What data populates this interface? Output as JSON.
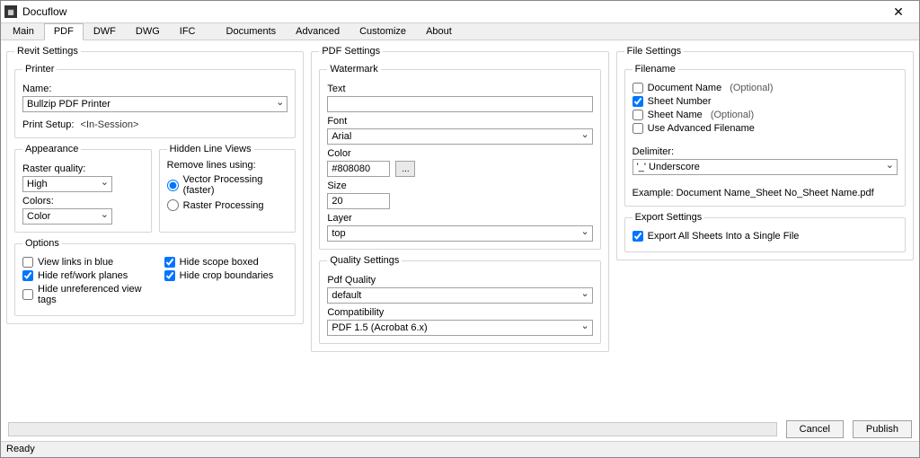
{
  "window": {
    "title": "Docuflow"
  },
  "tabs": [
    "Main",
    "PDF",
    "DWF",
    "DWG",
    "IFC",
    "Documents",
    "Advanced",
    "Customize",
    "About"
  ],
  "active_tab": "PDF",
  "revit": {
    "legend": "Revit Settings",
    "printer": {
      "legend": "Printer",
      "name_label": "Name:",
      "name_value": "Bullzip PDF Printer",
      "setup_label": "Print Setup:",
      "setup_value": "<In-Session>"
    },
    "appearance": {
      "legend": "Appearance",
      "raster_label": "Raster quality:",
      "raster_value": "High",
      "colors_label": "Colors:",
      "colors_value": "Color"
    },
    "hidden": {
      "legend": "Hidden Line Views",
      "remove_label": "Remove lines using:",
      "vector": "Vector Processing (faster)",
      "raster": "Raster Processing"
    },
    "options": {
      "legend": "Options",
      "view_links": "View links in blue",
      "hide_ref": "Hide ref/work planes",
      "hide_unref": "Hide unreferenced view tags",
      "hide_scope": "Hide scope boxed",
      "hide_crop": "Hide crop boundaries"
    }
  },
  "pdf": {
    "legend": "PDF Settings",
    "watermark": {
      "legend": "Watermark",
      "text_label": "Text",
      "text_value": "",
      "font_label": "Font",
      "font_value": "Arial",
      "color_label": "Color",
      "color_value": "#808080",
      "color_btn": "...",
      "size_label": "Size",
      "size_value": "20",
      "layer_label": "Layer",
      "layer_value": "top"
    },
    "quality": {
      "legend": "Quality Settings",
      "pdfq_label": "Pdf Quality",
      "pdfq_value": "default",
      "compat_label": "Compatibility",
      "compat_value": "PDF 1.5 (Acrobat 6.x)"
    }
  },
  "file": {
    "legend": "File Settings",
    "filename": {
      "legend": "Filename",
      "doc_name": "Document Name",
      "sheet_num": "Sheet Number",
      "sheet_name": "Sheet Name",
      "advanced": "Use Advanced Filename",
      "optional": "(Optional)",
      "delim_label": "Delimiter:",
      "delim_value": "'_' Underscore",
      "example": "Example: Document Name_Sheet No_Sheet Name.pdf"
    },
    "export": {
      "legend": "Export Settings",
      "single": "Export All Sheets Into a Single File"
    }
  },
  "buttons": {
    "cancel": "Cancel",
    "publish": "Publish"
  },
  "status": "Ready"
}
